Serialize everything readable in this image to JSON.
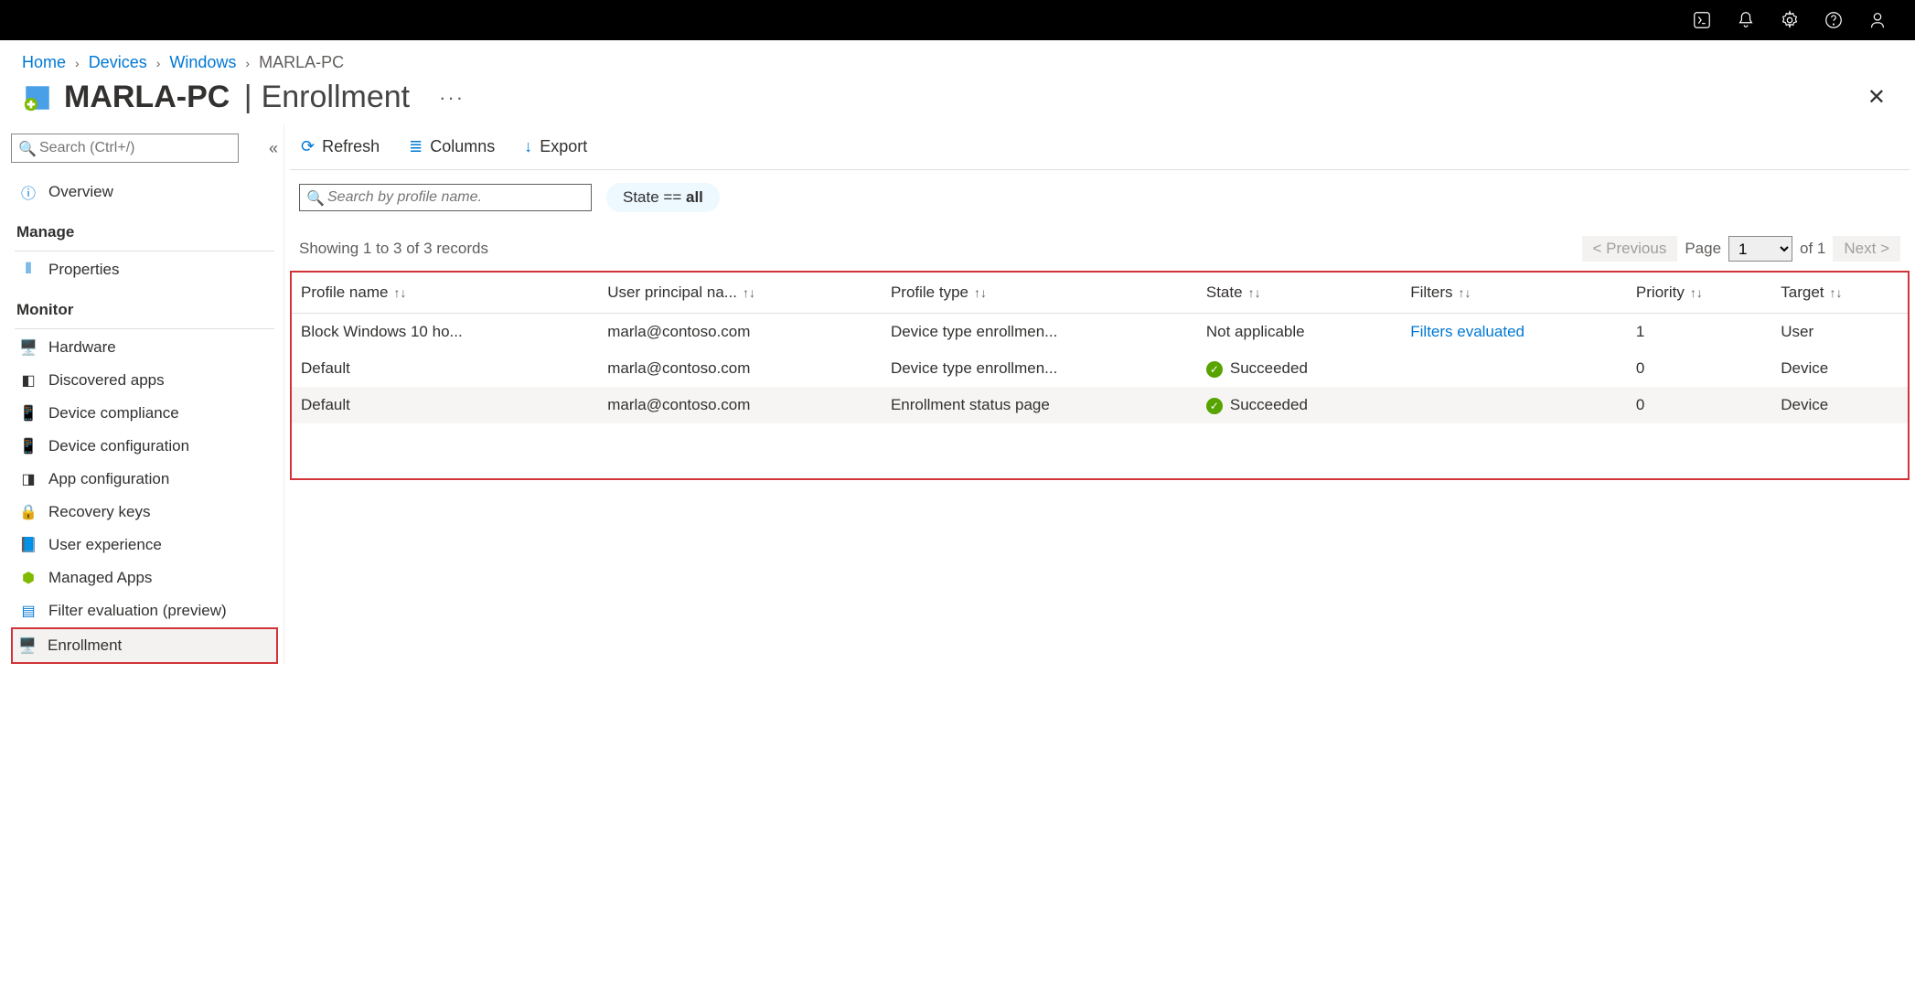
{
  "breadcrumb": [
    "Home",
    "Devices",
    "Windows",
    "MARLA-PC"
  ],
  "title": {
    "device": "MARLA-PC",
    "section": "Enrollment"
  },
  "sidebar": {
    "search_placeholder": "Search (Ctrl+/)",
    "overview": "Overview",
    "sections": {
      "manage": "Manage",
      "monitor": "Monitor"
    },
    "manage_items": [
      "Properties"
    ],
    "monitor_items": [
      "Hardware",
      "Discovered apps",
      "Device compliance",
      "Device configuration",
      "App configuration",
      "Recovery keys",
      "User experience",
      "Managed Apps",
      "Filter evaluation (preview)",
      "Enrollment"
    ],
    "active": "Enrollment"
  },
  "toolbar": {
    "refresh": "Refresh",
    "columns": "Columns",
    "export": "Export"
  },
  "filter": {
    "search_placeholder": "Search by profile name.",
    "pill_label": "State == ",
    "pill_value": "all"
  },
  "records_text": "Showing 1 to 3 of 3 records",
  "pager": {
    "prev": "< Previous",
    "page_label": "Page",
    "page_value": "1",
    "of_text": "of 1",
    "next": "Next >"
  },
  "columns": [
    "Profile name",
    "User principal na...",
    "Profile type",
    "State",
    "Filters",
    "Priority",
    "Target"
  ],
  "rows": [
    {
      "profile": "Block Windows 10 ho...",
      "upn": "marla@contoso.com",
      "type": "Device type enrollmen...",
      "state": "Not applicable",
      "state_ok": false,
      "filters": "Filters evaluated",
      "filters_link": true,
      "priority": "1",
      "target": "User"
    },
    {
      "profile": "Default",
      "upn": "marla@contoso.com",
      "type": "Device type enrollmen...",
      "state": "Succeeded",
      "state_ok": true,
      "filters": "",
      "filters_link": false,
      "priority": "0",
      "target": "Device"
    },
    {
      "profile": "Default",
      "upn": "marla@contoso.com",
      "type": "Enrollment status page",
      "state": "Succeeded",
      "state_ok": true,
      "filters": "",
      "filters_link": false,
      "priority": "0",
      "target": "Device"
    }
  ]
}
